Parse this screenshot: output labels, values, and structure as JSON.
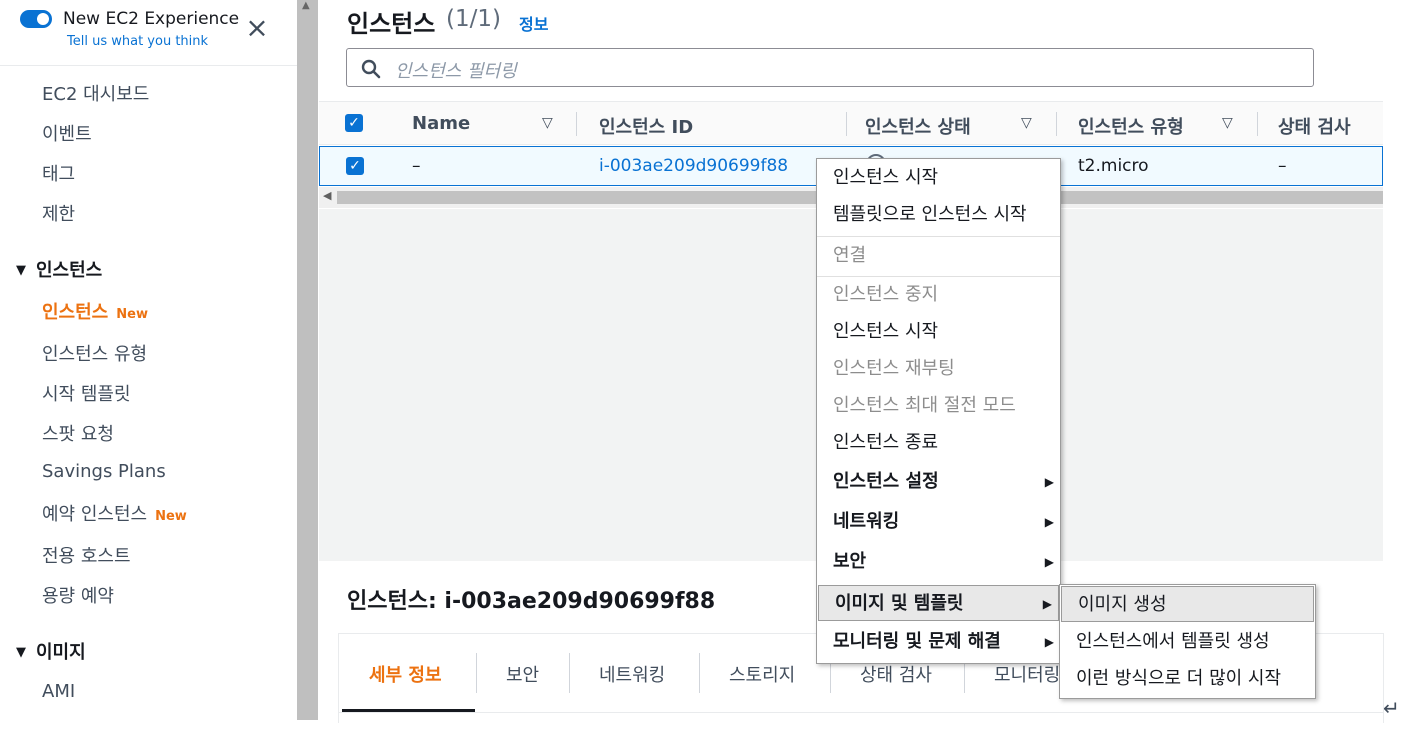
{
  "sidebar": {
    "toggle_label": "New EC2 Experience",
    "feedback_link": "Tell us what you think",
    "close_icon": "close-icon",
    "top_items": [
      "EC2 대시보드",
      "이벤트",
      "태그",
      "제한"
    ],
    "section_instances": "인스턴스",
    "instance_items": [
      {
        "label": "인스턴스",
        "badge": "New",
        "active": true
      },
      {
        "label": "인스턴스 유형",
        "badge": ""
      },
      {
        "label": "시작 템플릿",
        "badge": ""
      },
      {
        "label": "스팟 요청",
        "badge": ""
      },
      {
        "label": "Savings Plans",
        "badge": ""
      },
      {
        "label": "예약 인스턴스",
        "badge": "New"
      },
      {
        "label": "전용 호스트",
        "badge": ""
      },
      {
        "label": "용량 예약",
        "badge": ""
      }
    ],
    "section_images": "이미지",
    "image_items": [
      "AMI"
    ]
  },
  "header": {
    "title": "인스턴스",
    "count": "(1/1)",
    "info": "정보"
  },
  "search": {
    "placeholder": "인스턴스 필터링",
    "icon": "search-icon"
  },
  "table": {
    "columns": [
      "Name",
      "인스턴스 ID",
      "인스턴스 상태",
      "인스턴스 유형",
      "상태 검사"
    ],
    "rows": [
      {
        "name": "–",
        "id": "i-003ae209d90699f88",
        "type": "t2.micro",
        "check": "–",
        "selected": true
      }
    ]
  },
  "context_menu": {
    "items": [
      {
        "label": "인스턴스 시작",
        "disabled": false
      },
      {
        "label": "템플릿으로 인스턴스 시작",
        "disabled": false
      },
      {
        "label": "연결",
        "disabled": true
      },
      {
        "label": "인스턴스 중지",
        "disabled": true
      },
      {
        "label": "인스턴스 시작",
        "disabled": false
      },
      {
        "label": "인스턴스 재부팅",
        "disabled": true
      },
      {
        "label": "인스턴스 최대 절전 모드",
        "disabled": true
      },
      {
        "label": "인스턴스 종료",
        "disabled": false
      },
      {
        "label": "인스턴스 설정",
        "submenu": true
      },
      {
        "label": "네트워킹",
        "submenu": true
      },
      {
        "label": "보안",
        "submenu": true
      },
      {
        "label": "이미지 및 템플릿",
        "submenu": true,
        "highlighted": true
      },
      {
        "label": "모니터링 및 문제 해결",
        "submenu": true
      }
    ],
    "submenu": [
      "이미지 생성",
      "인스턴스에서 템플릿 생성",
      "이런 방식으로 더 많이 시작"
    ]
  },
  "details": {
    "title": "인스턴스: i-003ae209d90699f88",
    "tabs": [
      "세부 정보",
      "보안",
      "네트워킹",
      "스토리지",
      "상태 검사",
      "모니터링"
    ],
    "active_tab": "세부 정보"
  },
  "colors": {
    "accent": "#0972d3",
    "active_nav": "#ec7211",
    "table_area": "#f2f3f3"
  }
}
